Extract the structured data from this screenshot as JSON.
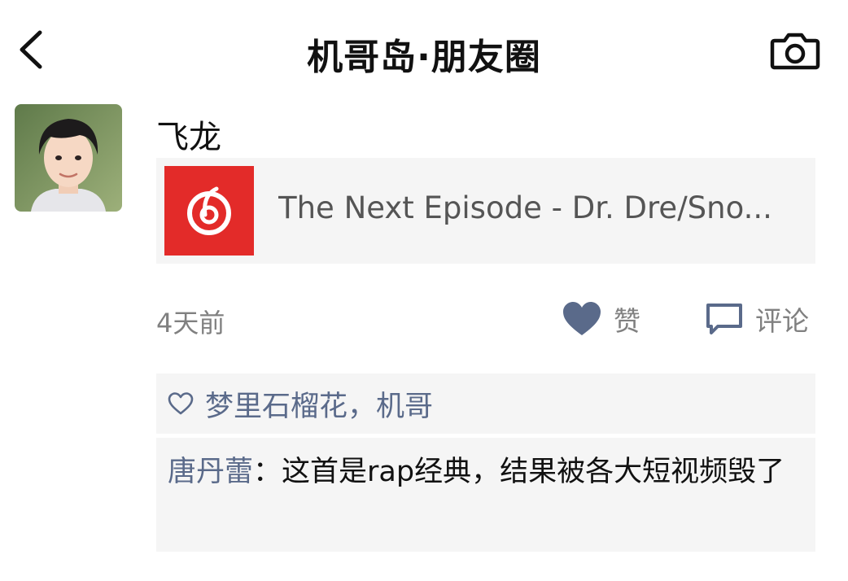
{
  "nav": {
    "title": "机哥岛·朋友圈",
    "back_icon": "chevron-left-icon",
    "camera_icon": "camera-icon"
  },
  "post": {
    "author": "飞龙",
    "avatar_icon": "avatar-photo",
    "music": {
      "cover_icon": "netease-music-icon",
      "cover_color": "#e32b29",
      "title": "The Next Episode - Dr. Dre/Sno..."
    },
    "time": "4天前",
    "like_label": "赞",
    "comment_label": "评论"
  },
  "likes": {
    "names": "梦里石榴花，机哥"
  },
  "comments": [
    {
      "author": "唐丹蕾",
      "separator": "：",
      "text": "这首是rap经典，结果被各大短视频毁了"
    }
  ],
  "colors": {
    "link_blue": "#5a6a8a",
    "panel_gray": "#f5f5f5",
    "meta_gray": "#808080"
  }
}
